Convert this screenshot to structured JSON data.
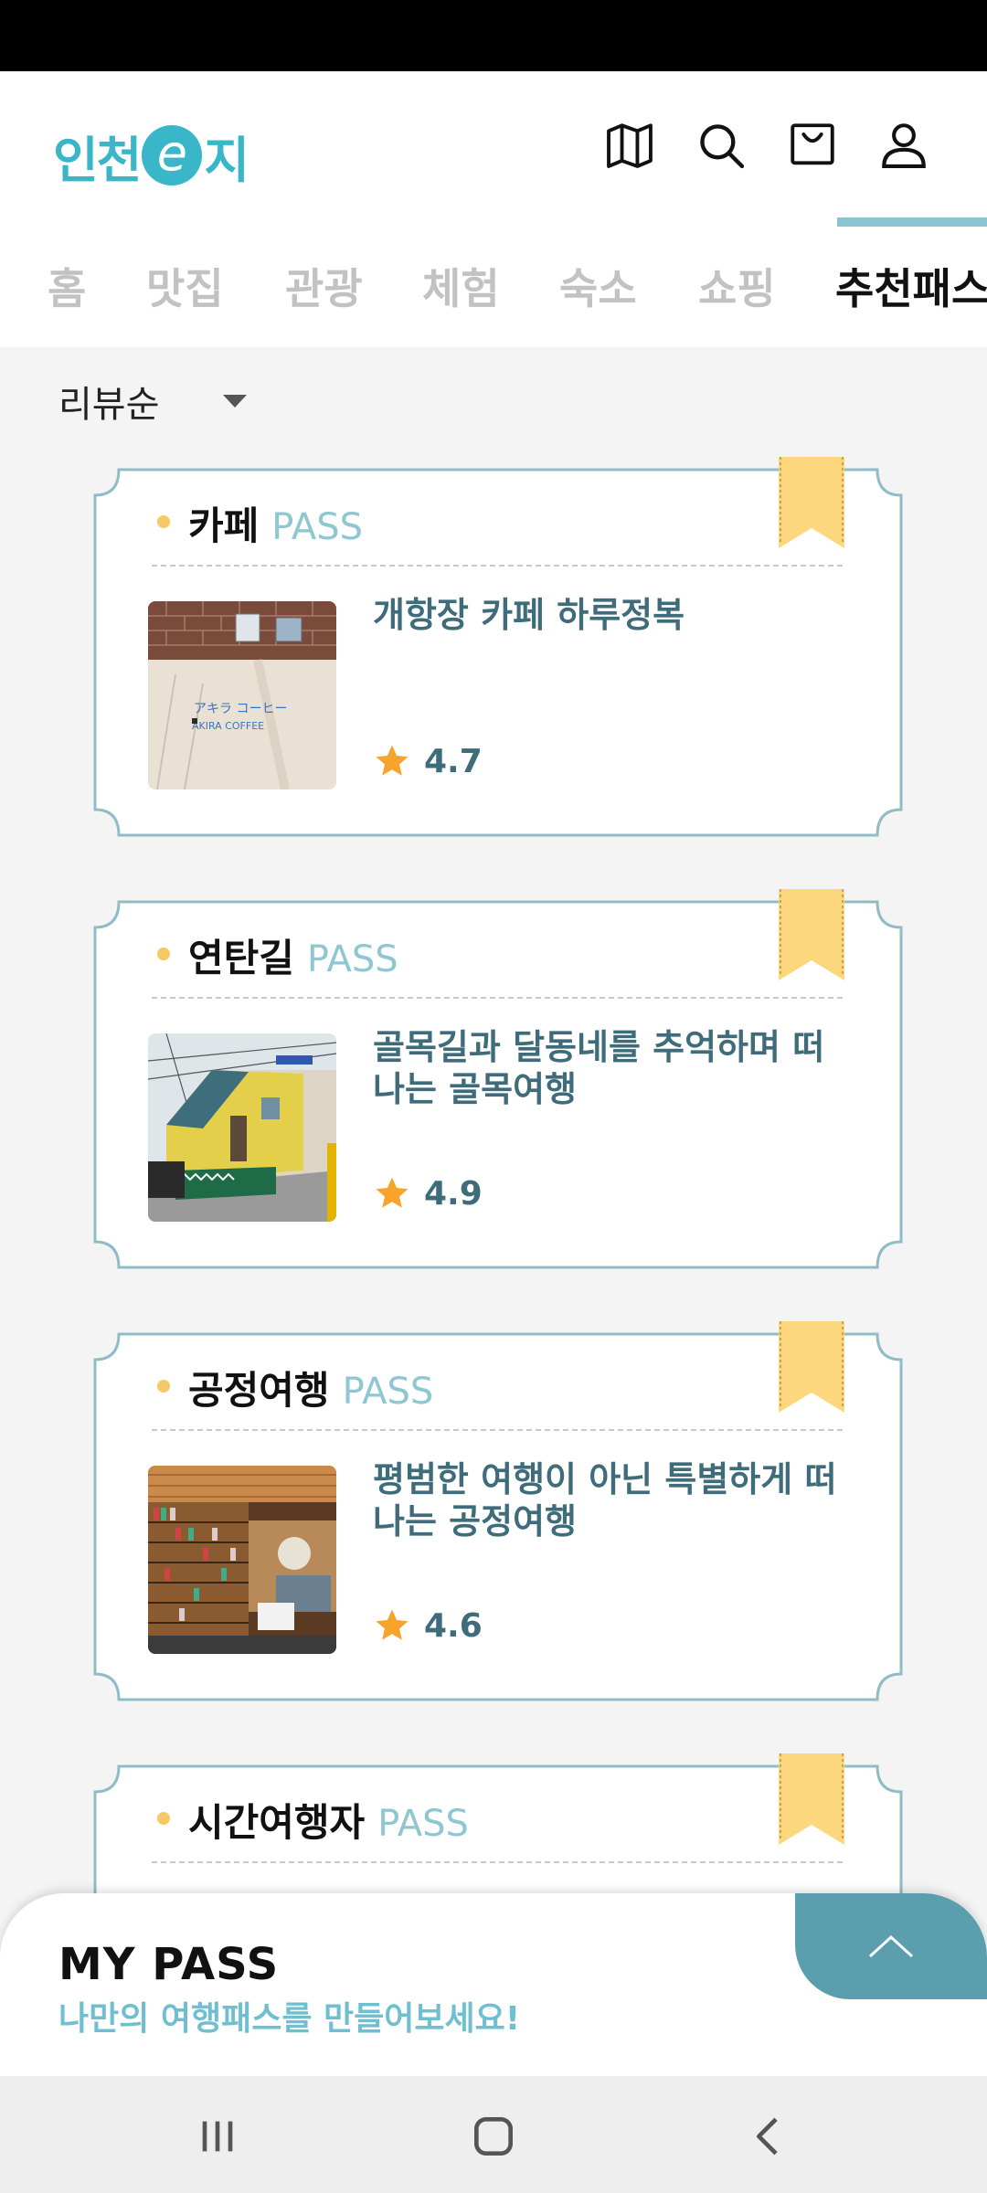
{
  "app": {
    "logo_text_left": "인천",
    "logo_text_e": "e",
    "logo_text_right": "지"
  },
  "header_icons": [
    "map-icon",
    "search-icon",
    "cart-icon",
    "user-icon"
  ],
  "tabs": [
    {
      "label": "홈"
    },
    {
      "label": "맛집"
    },
    {
      "label": "관광"
    },
    {
      "label": "체험"
    },
    {
      "label": "숙소"
    },
    {
      "label": "쇼핑"
    },
    {
      "label": "추천패스"
    }
  ],
  "sort": {
    "label": "리뷰순"
  },
  "cards": [
    {
      "title": "카페",
      "pass": "PASS",
      "desc": "개항장 카페 하루정복",
      "rating": "4.7"
    },
    {
      "title": "연탄길",
      "pass": "PASS",
      "desc": "골목길과 달동네를 추억하며 떠나는 골목여행",
      "rating": "4.9"
    },
    {
      "title": "공정여행",
      "pass": "PASS",
      "desc": "평범한 여행이 아닌 특별하게 떠나는 공정여행",
      "rating": "4.6"
    },
    {
      "title": "시간여행자",
      "pass": "PASS",
      "desc": "",
      "rating": ""
    }
  ],
  "thumb_cafe_sign": "アキラ コーヒー",
  "thumb_cafe_sign2": "AKIRA COFFEE",
  "mypass": {
    "title": "MY PASS",
    "subtitle": "나만의 여행패스를 만들어보세요!"
  },
  "colors": {
    "accent": "#39b7c8",
    "pass": "#8ec6d2",
    "card_border": "#8fbcc7",
    "ribbon": "#fdd77e",
    "toggle": "#5b9fae"
  }
}
